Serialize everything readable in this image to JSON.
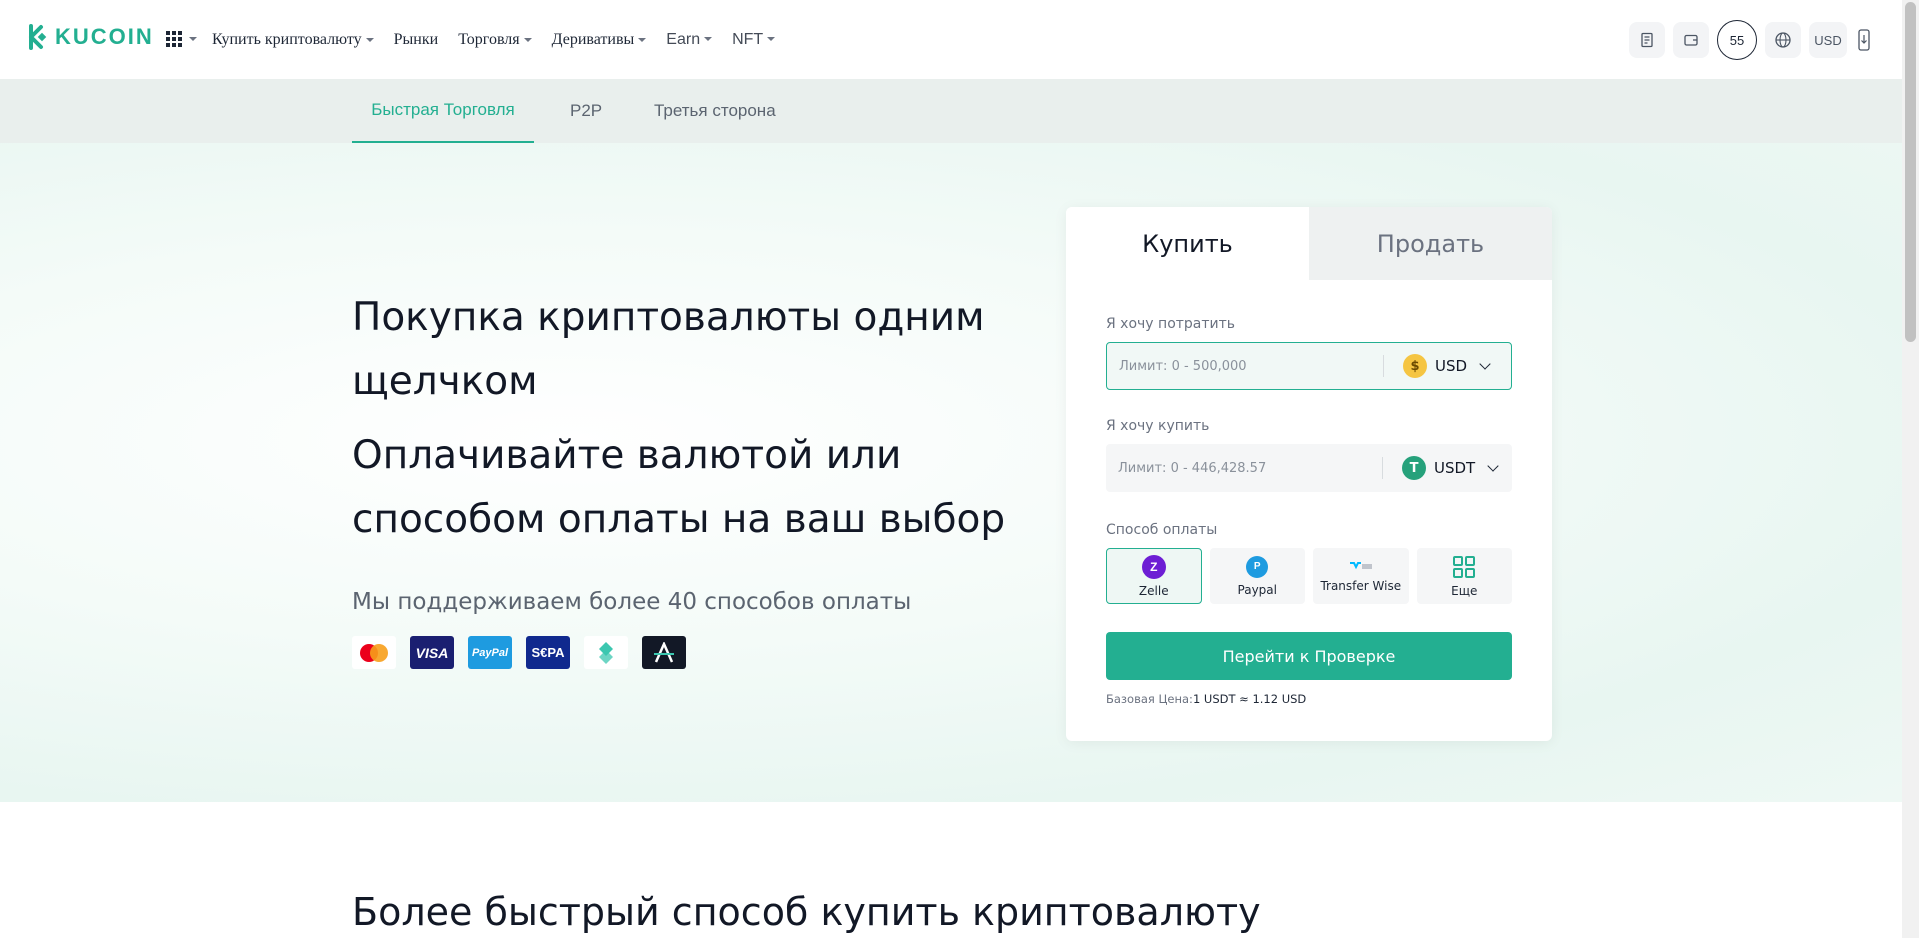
{
  "brand": {
    "name": "KUCOIN",
    "color": "#23af91"
  },
  "nav": {
    "menu": [
      {
        "label": "Купить криптовалюту",
        "dropdown": true
      },
      {
        "label": "Рынки",
        "dropdown": false
      },
      {
        "label": "Торговля",
        "dropdown": true
      },
      {
        "label": "Деривативы",
        "dropdown": true
      },
      {
        "label": "Earn",
        "dropdown": true
      },
      {
        "label": "NFT",
        "dropdown": true
      }
    ],
    "right": {
      "notifications_count": "55",
      "currency": "USD"
    }
  },
  "subnav": {
    "tabs": [
      {
        "label": "Быстрая Торговля",
        "active": true
      },
      {
        "label": "P2P",
        "active": false
      },
      {
        "label": "Третья сторона",
        "active": false
      }
    ]
  },
  "hero": {
    "title1": "Покупка криптовалюты одним щелчком",
    "title2": "Оплачивайте валютой или способом оплаты на ваш выбор",
    "support_prefix": "Мы поддерживаем более ",
    "support_count": "40",
    "support_suffix": " способов оплаты",
    "payment_logos": [
      "mastercard-icon",
      "visa-icon",
      "paypal-icon",
      "sepa-icon",
      "bitpay-icon",
      "advcash-icon"
    ]
  },
  "card": {
    "tabs": {
      "buy": "Купить",
      "sell": "Продать"
    },
    "spend": {
      "label": "Я хочу потратить",
      "placeholder": "Лимит: 0 - 500,000",
      "currency": "USD"
    },
    "receive": {
      "label": "Я хочу купить",
      "placeholder": "Лимит: 0 - 446,428.57",
      "currency": "USDT"
    },
    "payment": {
      "label": "Способ оплаты",
      "methods": [
        {
          "label": "Zelle",
          "selected": true,
          "color": "#6d1ed4"
        },
        {
          "label": "Paypal",
          "selected": false,
          "color": "#1e9be0"
        },
        {
          "label": "Transfer Wise",
          "selected": false,
          "color": "#00b9ff"
        },
        {
          "label": "Еще",
          "selected": false,
          "color": "#23af91"
        }
      ]
    },
    "cta": "Перейти к Проверке",
    "base_price_label": "Базовая Цена:",
    "base_price_value": "1 USDT ≈ 1.12 USD"
  },
  "section2": {
    "title": "Более быстрый способ купить криптовалюту"
  }
}
